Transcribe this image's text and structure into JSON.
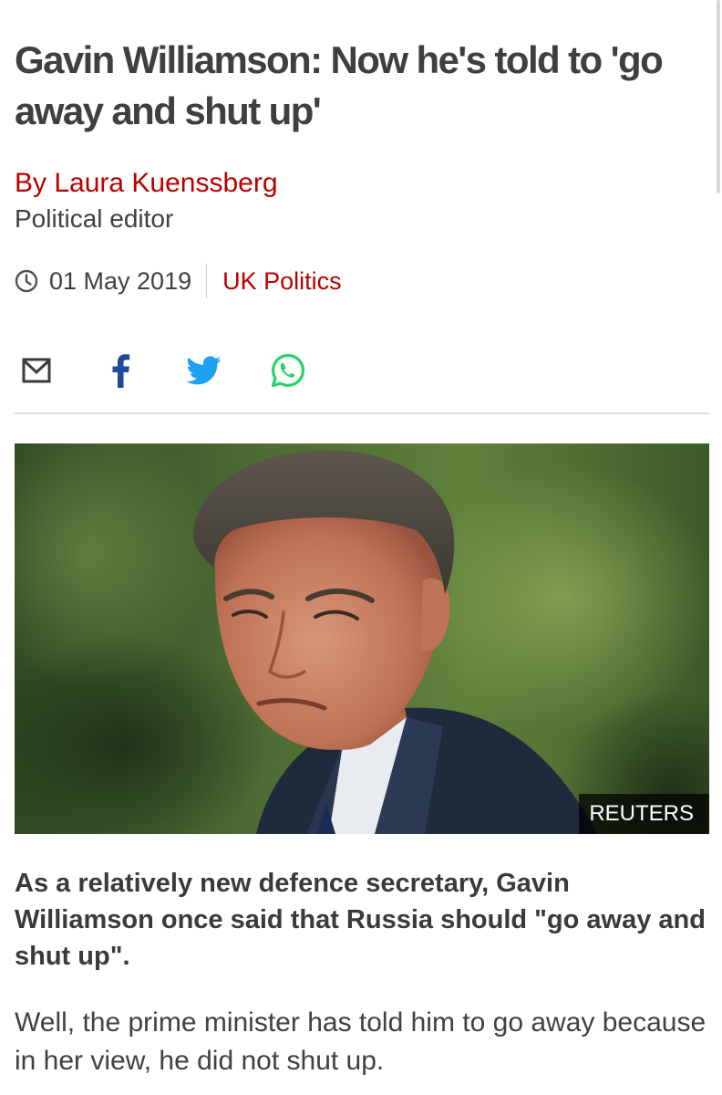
{
  "article": {
    "headline": "Gavin Williamson: Now he's told to 'go away and shut up'",
    "author": "By Laura Kuenssberg",
    "author_role": "Political editor",
    "date": "01 May 2019",
    "section": "UK Politics",
    "share_icons": [
      "email-icon",
      "facebook-icon",
      "twitter-icon",
      "whatsapp-icon"
    ],
    "image_credit": "REUTERS",
    "intro": "As a relatively new defence secretary, Gavin Williamson once said that Russia should \"go away and shut up\".",
    "body": "Well, the prime minister has told him to go away because in her view, he did not shut up."
  },
  "colors": {
    "headline": "#3f3f42",
    "byline_accent": "#b80000",
    "facebook": "#1d4b9b",
    "twitter": "#1da1f2",
    "whatsapp": "#25d366"
  }
}
